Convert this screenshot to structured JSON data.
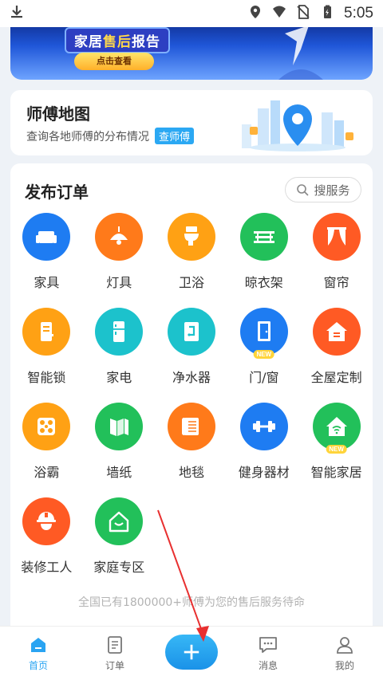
{
  "status_bar": {
    "time": "5:05"
  },
  "banner": {
    "title_part1": "家居",
    "title_part2": "售后",
    "title_part3": "报告",
    "button": "点击查看"
  },
  "master_map": {
    "title": "师傅地图",
    "subtitle": "查询各地师傅的分布情况",
    "tag": "查师傅"
  },
  "orders": {
    "title": "发布订单",
    "search_placeholder": "搜服务",
    "services": [
      {
        "label": "家具",
        "icon": "sofa-icon",
        "color": "#1e7cf2"
      },
      {
        "label": "灯具",
        "icon": "lamp-icon",
        "color": "#ff7a1a"
      },
      {
        "label": "卫浴",
        "icon": "toilet-icon",
        "color": "#ffa114"
      },
      {
        "label": "晾衣架",
        "icon": "drying-rack-icon",
        "color": "#22c05a"
      },
      {
        "label": "窗帘",
        "icon": "curtain-icon",
        "color": "#ff5a24"
      },
      {
        "label": "智能锁",
        "icon": "smart-lock-icon",
        "color": "#ffa114"
      },
      {
        "label": "家电",
        "icon": "fridge-icon",
        "color": "#1cc2cc"
      },
      {
        "label": "净水器",
        "icon": "water-purifier-icon",
        "color": "#1cc2cc"
      },
      {
        "label": "门/窗",
        "icon": "door-icon",
        "color": "#1e7cf2",
        "badge": "NEW"
      },
      {
        "label": "全屋定制",
        "icon": "house-icon",
        "color": "#ff5a24"
      },
      {
        "label": "浴霸",
        "icon": "heater-icon",
        "color": "#ffa114"
      },
      {
        "label": "墙纸",
        "icon": "wallpaper-icon",
        "color": "#22c05a"
      },
      {
        "label": "地毯",
        "icon": "carpet-icon",
        "color": "#ff7a1a"
      },
      {
        "label": "健身器材",
        "icon": "dumbbell-icon",
        "color": "#1e7cf2"
      },
      {
        "label": "智能家居",
        "icon": "smart-home-icon",
        "color": "#22c05a",
        "badge": "NEW"
      },
      {
        "label": "装修工人",
        "icon": "worker-icon",
        "color": "#ff5a24"
      },
      {
        "label": "家庭专区",
        "icon": "home-zone-icon",
        "color": "#22c05a"
      }
    ],
    "footnote": "全国已有1800000+师傅为您的售后服务待命"
  },
  "bottom_nav": {
    "items": [
      {
        "label": "首页",
        "icon": "home-icon",
        "active": true
      },
      {
        "label": "订单",
        "icon": "order-icon"
      },
      {
        "label": "",
        "icon": "plus-icon"
      },
      {
        "label": "消息",
        "icon": "message-icon"
      },
      {
        "label": "我的",
        "icon": "profile-icon"
      }
    ]
  },
  "colors": {
    "accent": "#2aa4f2",
    "annotation_arrow": "#e83030"
  }
}
